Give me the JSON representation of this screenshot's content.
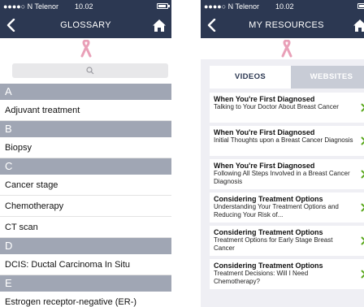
{
  "glossary_screen": {
    "status": {
      "carrier": "●●●●○ N Telenor",
      "time": "10.02"
    },
    "nav": {
      "title": "GLOSSARY"
    },
    "search": {
      "placeholder": ""
    },
    "sections": [
      {
        "letter": "A",
        "items": [
          "Adjuvant treatment"
        ]
      },
      {
        "letter": "B",
        "items": [
          "Biopsy"
        ]
      },
      {
        "letter": "C",
        "items": [
          "Cancer stage",
          "Chemotherapy",
          "CT scan"
        ]
      },
      {
        "letter": "D",
        "items": [
          "DCIS: Ductal Carcinoma In Situ"
        ]
      },
      {
        "letter": "E",
        "items": [
          "Estrogen receptor-negative (ER-)"
        ]
      }
    ]
  },
  "resources_screen": {
    "status": {
      "carrier": "●●●●○ N Telenor",
      "time": "10.02"
    },
    "nav": {
      "title": "MY RESOURCES"
    },
    "tabs": {
      "videos": "VIDEOS",
      "websites": "WEBSITES"
    },
    "cards": [
      {
        "title": "When You're First Diagnosed",
        "subtitle": "Talking to Your Doctor About Breast Cancer"
      },
      {
        "title": "When You're First Diagnosed",
        "subtitle": "Initial Thoughts upon a Breast Cancer Diagnosis"
      },
      {
        "title": "When You're First Diagnosed",
        "subtitle": "Following All Steps Involved in a Breast Cancer Diagnosis"
      },
      {
        "title": "Considering Treatment Options",
        "subtitle": "Understanding Your Treatment Options and Reducing Your Risk of..."
      },
      {
        "title": "Considering Treatment Options",
        "subtitle": "Treatment Options for Early Stage Breast Cancer"
      },
      {
        "title": "Considering Treatment Options",
        "subtitle": "Treatment Decisions: Will I Need Chemotherapy?"
      }
    ]
  },
  "colors": {
    "navbar": "#2c3852",
    "section_header": "#a0a6b4",
    "ribbon": "#e9a0b8",
    "chevron": "#5ba91e",
    "tab_inactive": "#c8ccd6"
  },
  "icons": {
    "back": "chevron-left-icon",
    "home": "home-icon",
    "ribbon": "pink-ribbon-icon",
    "search": "magnifier-icon",
    "row": "chevron-right-icon"
  }
}
